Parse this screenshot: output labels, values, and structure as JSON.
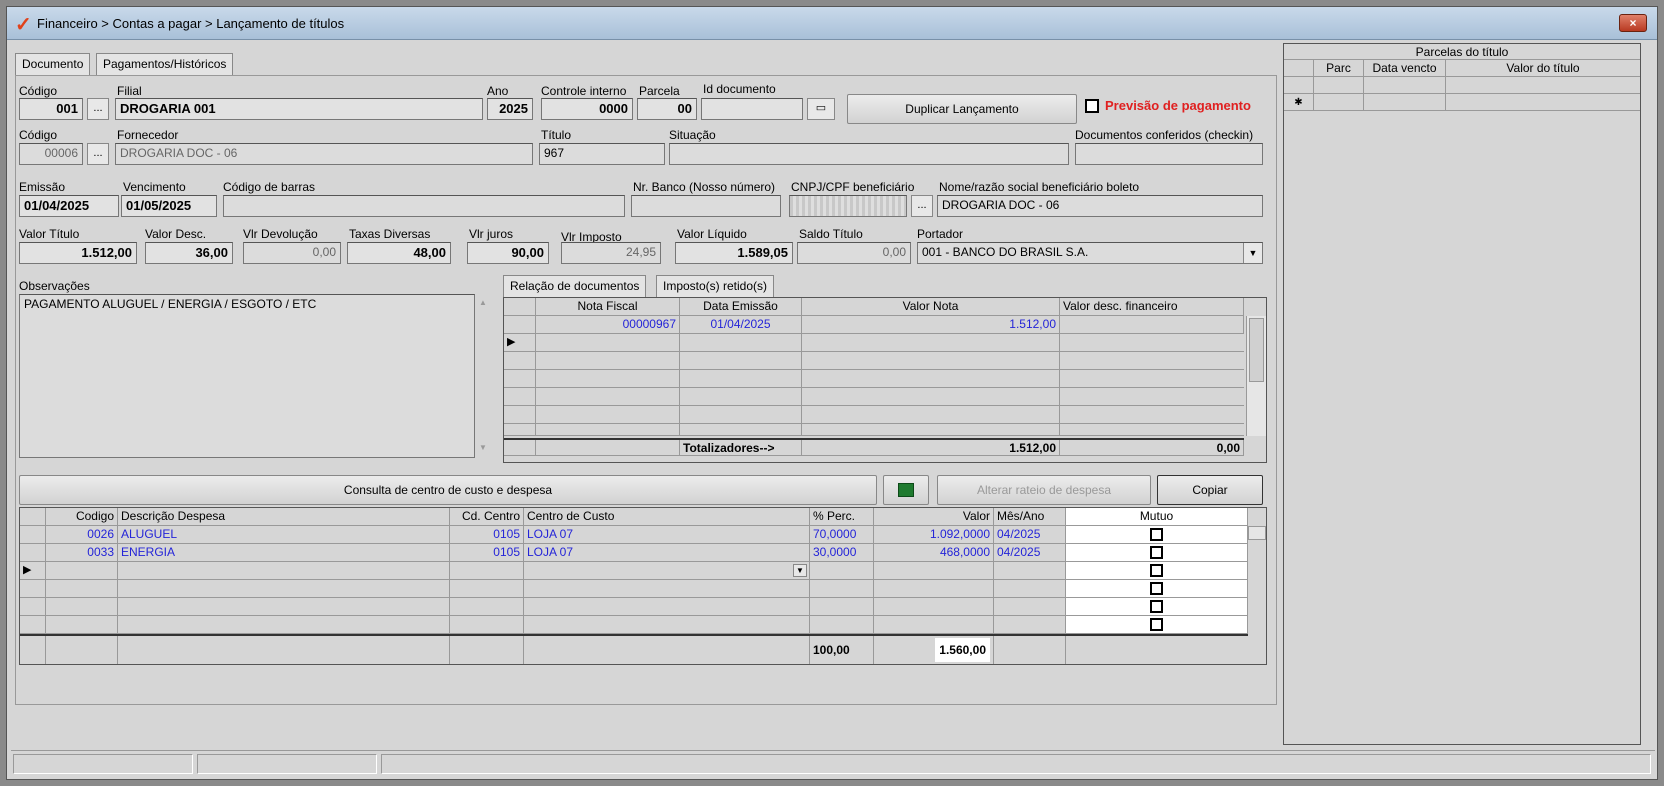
{
  "window": {
    "title": "Financeiro > Contas a pagar > Lançamento de títulos",
    "close_label": "×"
  },
  "tabs": [
    "Documento",
    "Pagamentos/Históricos"
  ],
  "fields": {
    "codigo_label": "Código",
    "codigo_value": "001",
    "filial_label": "Filial",
    "filial_value": "DROGARIA 001",
    "ano_label": "Ano",
    "ano_value": "2025",
    "controle_label": "Controle interno",
    "controle_value": "0000",
    "parcela_label": "Parcela",
    "parcela_value": "00",
    "iddoc_label": "Id documento",
    "iddoc_value": "",
    "duplicar_label": "Duplicar Lançamento",
    "previsao_label": "Previsão de pagamento",
    "codigo2_label": "Código",
    "codigo2_value": "00006",
    "fornecedor_label": "Fornecedor",
    "fornecedor_value": "DROGARIA DOC - 06",
    "titulo_label": "Título",
    "titulo_value": "967",
    "situacao_label": "Situação",
    "situacao_value": "",
    "conferidos_label": "Documentos conferidos (checkin)",
    "conferidos_value": "",
    "emissao_label": "Emissão",
    "emissao_value": "01/04/2025",
    "vencimento_label": "Vencimento",
    "vencimento_value": "01/05/2025",
    "barras_label": "Código de barras",
    "barras_value": "",
    "nrbanco_label": "Nr. Banco (Nosso número)",
    "nrbanco_value": "",
    "cnpj_label": "CNPJ/CPF beneficiário",
    "nome_label": "Nome/razão social beneficiário boleto",
    "nome_value": "DROGARIA DOC - 06",
    "valor_titulo_label": "Valor Título",
    "valor_titulo_value": "1.512,00",
    "valor_desc_label": "Valor Desc.",
    "valor_desc_value": "36,00",
    "vlr_devol_label": "Vlr Devolução",
    "vlr_devol_value": "0,00",
    "taxas_label": "Taxas Diversas",
    "taxas_value": "48,00",
    "juros_label": "Vlr juros",
    "juros_value": "90,00",
    "imposto_label": "Vlr Imposto",
    "imposto_value": "24,95",
    "liquido_label": "Valor Líquido",
    "liquido_value": "1.589,05",
    "saldo_label": "Saldo Título",
    "saldo_value": "0,00",
    "portador_label": "Portador",
    "portador_value": "001 - BANCO DO BRASIL S.A.",
    "obs_label": "Observações",
    "obs_value": "PAGAMENTO ALUGUEL / ENERGIA / ESGOTO / ETC"
  },
  "doc_tabs": [
    "Relação de documentos",
    "Imposto(s) retido(s)"
  ],
  "doc_grid": {
    "headers": [
      "Nota Fiscal",
      "Data Emissão",
      "Valor Nota",
      "Valor desc. financeiro"
    ],
    "rows": [
      [
        "00000967",
        "01/04/2025",
        "1.512,00",
        ""
      ]
    ],
    "total_label": "Totalizadores-->",
    "total_valor": "1.512,00",
    "total_desc": "0,00"
  },
  "parcelas": {
    "title": "Parcelas do título",
    "headers": [
      "Parc",
      "Data vencto",
      "Valor do título"
    ]
  },
  "centro": {
    "consulta_label": "Consulta de centro de custo e despesa",
    "alterar_label": "Alterar rateio de despesa",
    "copiar_label": "Copiar",
    "headers": [
      "Codigo",
      "Descrição Despesa",
      "Cd. Centro",
      "Centro de Custo",
      "% Perc.",
      "Valor",
      "Mês/Ano",
      "Mutuo"
    ],
    "rows": [
      [
        "0026",
        "ALUGUEL",
        "0105",
        "LOJA 07",
        "70,0000",
        "1.092,0000",
        "04/2025"
      ],
      [
        "0033",
        "ENERGIA",
        "0105",
        "LOJA 07",
        "30,0000",
        "468,0000",
        "04/2025"
      ]
    ],
    "total_perc": "100,00",
    "total_valor": "1.560,00"
  }
}
